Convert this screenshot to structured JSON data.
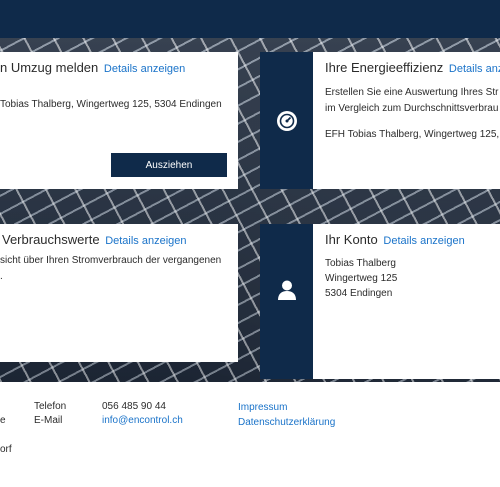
{
  "move_card": {
    "title": "n Umzug melden",
    "details": "Details anzeigen",
    "address": "Tobias Thalberg, Wingertweg 125, 5304 Endingen",
    "button": "Ausziehen"
  },
  "energy_card": {
    "title": "Ihre Energieeffizienz",
    "details": "Details anzeigen",
    "line1": "Erstellen Sie eine Auswertung Ihres Str",
    "line2": "im Vergleich zum Durchschnittsverbrau",
    "line3": "EFH Tobias Thalberg, Wingertweg 125,",
    "icon": "gauge-icon"
  },
  "usage_card": {
    "title": "Verbrauchswerte",
    "details": "Details anzeigen",
    "line1": "sicht über Ihren Stromverbrauch der vergangenen",
    "line2": "."
  },
  "account_card": {
    "title": "Ihr Konto",
    "details": "Details anzeigen",
    "name": "Tobias Thalberg",
    "street": "Wingertweg 125",
    "city": "5304 Endingen",
    "icon": "user-icon"
  },
  "footer": {
    "col1_line1": "e",
    "col1_line2": "orf",
    "phone_label": "Telefon",
    "email_label": "E-Mail",
    "phone_value": "056 485 90 44",
    "email_value": "info@encontrol.ch",
    "impressum": "Impressum",
    "privacy": "Datenschutzerklärung"
  },
  "colors": {
    "navy": "#0f2a4a",
    "link": "#1a73c9"
  }
}
